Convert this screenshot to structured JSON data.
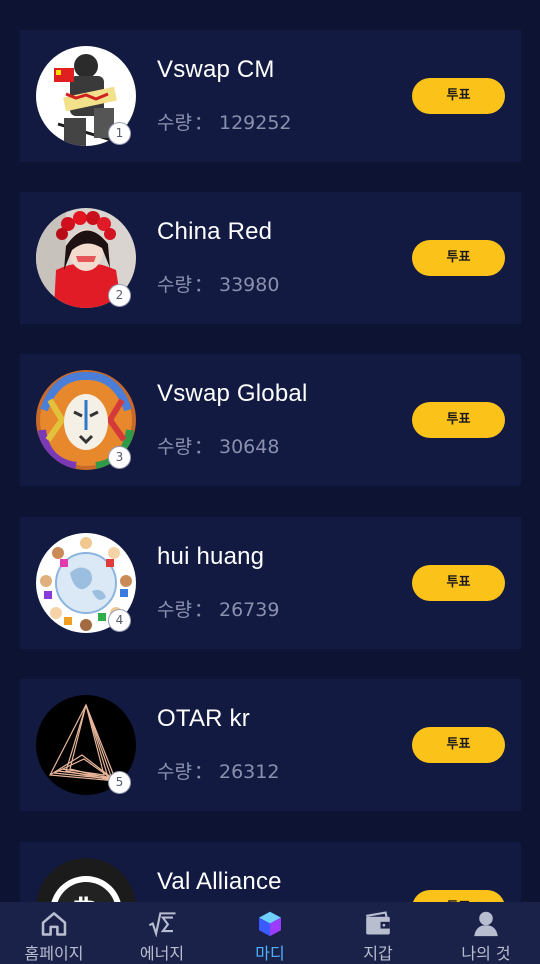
{
  "quantity_label": "수량",
  "quantity_separator": "：",
  "vote_label": "투표",
  "items": [
    {
      "name": "Vswap CM",
      "quantity": "129252",
      "rank": "1",
      "avatar": "worker-flag-avatar"
    },
    {
      "name": "China Red",
      "quantity": "33980",
      "rank": "2",
      "avatar": "woman-red-flowers-avatar"
    },
    {
      "name": "Vswap Global",
      "quantity": "30648",
      "rank": "3",
      "avatar": "colorful-lion-avatar"
    },
    {
      "name": "hui huang",
      "quantity": "26739",
      "rank": "4",
      "avatar": "children-around-globe-avatar"
    },
    {
      "name": "OTAR kr",
      "quantity": "26312",
      "rank": "5",
      "avatar": "copper-triangle-avatar"
    },
    {
      "name": "Val Alliance",
      "avatar": "bitcoin-avatar"
    }
  ],
  "tabs": [
    {
      "label": "홈페이지",
      "icon": "home-icon",
      "active": false
    },
    {
      "label": "에너지",
      "icon": "sqrt-sigma-icon",
      "active": false
    },
    {
      "label": "마디",
      "icon": "cube-icon",
      "active": true
    },
    {
      "label": "지갑",
      "icon": "wallet-icon",
      "active": false
    },
    {
      "label": "나의 것",
      "icon": "user-icon",
      "active": false
    }
  ],
  "colors": {
    "background": "#0d1433",
    "card": "#121a42",
    "vote_button": "#fbc21a",
    "active_tab": "#4fb1ff",
    "inactive_tab": "#b9bdd0"
  }
}
